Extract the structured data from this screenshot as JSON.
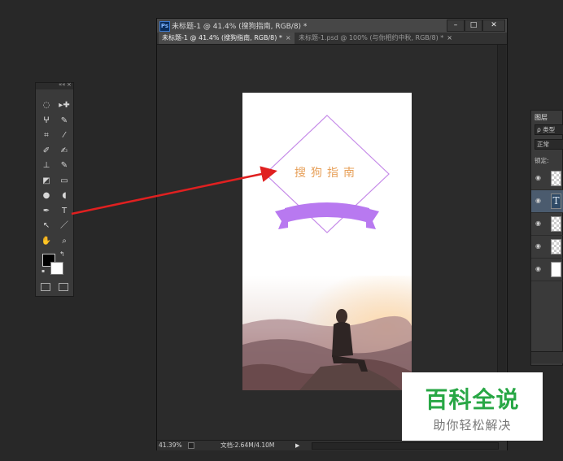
{
  "window": {
    "title": "未标题-1 @ 41.4% (搜狗指南, RGB/8) *",
    "ps_badge": "Ps",
    "minimize": "–",
    "maximize": "□",
    "close": "✕"
  },
  "tabs": [
    {
      "label": "未标题-1 @ 41.4% (搜狗指南, RGB/8) *",
      "close": "×"
    },
    {
      "label": "未标题-1.psd @ 100% (与你相约中秋, RGB/8) *",
      "close": "×"
    }
  ],
  "status": {
    "zoom": "41.39%",
    "doc_size": "文档:2.64M/4.10M",
    "arrow": "▶"
  },
  "canvas": {
    "logo_text": "搜狗指南",
    "colors": {
      "diamond_stroke": "#c58ae8",
      "ribbon": "#b879f0",
      "text": "#e7a05a"
    }
  },
  "toolbox": {
    "collapse": "««",
    "close": "×",
    "tools": [
      {
        "name": "marquee-tool",
        "glyph": "◌"
      },
      {
        "name": "move-tool",
        "glyph": "▸✚"
      },
      {
        "name": "lasso-tool",
        "glyph": "ⵖ"
      },
      {
        "name": "quick-select-tool",
        "glyph": "✎"
      },
      {
        "name": "crop-tool",
        "glyph": "⌗"
      },
      {
        "name": "eyedropper-tool",
        "glyph": "⁄"
      },
      {
        "name": "healing-brush-tool",
        "glyph": "✐"
      },
      {
        "name": "brush-tool",
        "glyph": "✍"
      },
      {
        "name": "clone-stamp-tool",
        "glyph": "⊥"
      },
      {
        "name": "history-brush-tool",
        "glyph": "✎"
      },
      {
        "name": "eraser-tool",
        "glyph": "◩"
      },
      {
        "name": "gradient-tool",
        "glyph": "▭"
      },
      {
        "name": "blur-tool",
        "glyph": "●"
      },
      {
        "name": "dodge-tool",
        "glyph": "◖"
      },
      {
        "name": "pen-tool",
        "glyph": "✒"
      },
      {
        "name": "type-tool",
        "glyph": "T"
      },
      {
        "name": "path-select-tool",
        "glyph": "↖"
      },
      {
        "name": "line-tool",
        "glyph": "／"
      },
      {
        "name": "hand-tool",
        "glyph": "✋"
      },
      {
        "name": "zoom-tool",
        "glyph": "⌕"
      }
    ],
    "swap": "↰"
  },
  "layers": {
    "tab": "图层",
    "filter": "ρ 类型",
    "blend": "正常",
    "lock": "锁定:",
    "eye": "◉",
    "text_thumb": "T"
  },
  "watermark": {
    "title": "百科全说",
    "subtitle": "助你轻松解决",
    "color": "#28a745"
  },
  "annotation": {
    "arrow_color": "#e02020"
  }
}
